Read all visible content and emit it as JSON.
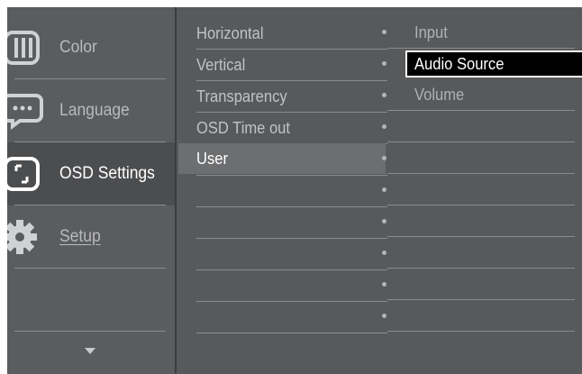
{
  "nav": {
    "items": [
      {
        "label": "Color",
        "icon": "color-bars-icon",
        "active": false
      },
      {
        "label": "Language",
        "icon": "speech-bubble-icon",
        "active": false
      },
      {
        "label": "OSD Settings",
        "icon": "osd-frame-icon",
        "active": true
      },
      {
        "label": "Setup",
        "icon": "gear-icon",
        "active": false
      }
    ],
    "scroll_icon": "scroll-down-arrow-icon"
  },
  "submenu": {
    "items": [
      "Horizontal",
      "Vertical",
      "Transparency",
      "OSD Time out",
      "User"
    ],
    "active": "User"
  },
  "options": {
    "items": [
      "Input",
      "Audio Source",
      "Volume"
    ],
    "selected": "Audio Source"
  },
  "colors": {
    "background": "#58595b",
    "highlight": "#6d6e70",
    "selected_box": "#000000",
    "text_active": "#ffffff",
    "text_inactive": "#b9babc"
  }
}
